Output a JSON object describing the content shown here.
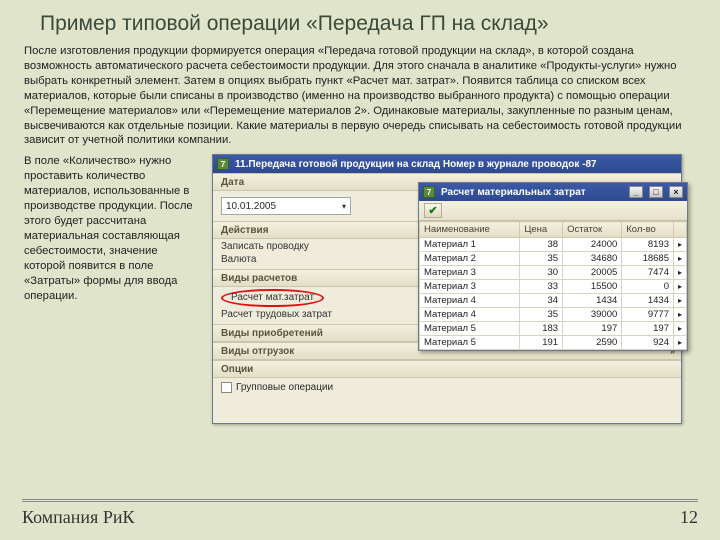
{
  "title": "Пример типовой операции «Передача ГП на склад»",
  "para1": "После изготовления продукции формируется операция «Передача готовой продукции на склад», в которой создана возможность автоматического расчета себестоимости продукции. Для этого сначала в аналитике «Продукты-услуги» нужно выбрать конкретный элемент. Затем в опциях выбрать пункт «Расчет мат. затрат». Появится таблица со списком всех материалов, которые были списаны в производство (именно на производство выбранного продукта) с помощью операции «Перемещение материалов» или «Перемещение материалов 2». Одинаковые материалы, закупленные по разным ценам, высвечиваются как отдельные позиции. Какие материалы в первую очередь списывать на себестоимость готовой продукции зависит от учетной политики компании.",
  "side": "В поле «Количество» нужно проставить количество материалов, использованные в производстве продукции. После этого будет рассчитана материальная составляющая себестоимости, значение которой появится в поле «Затраты» формы для ввода операции.",
  "win_main": {
    "title": "11.Передача готовой продукции на склад     Номер в журнале проводок -87",
    "section_date": "Дата",
    "date": "10.01.2005",
    "section_actions": "Действия",
    "action1": "Записать проводку",
    "action2": "Валюта",
    "section_calc": "Виды расчетов",
    "calc1": "Расчет мат.затрат",
    "calc2": "Расчет трудовых затрат",
    "section_acq": "Виды приобретений",
    "section_ship": "Виды отгрузок",
    "section_opts": "Опции",
    "chk_group": "Групповые операции"
  },
  "win_child": {
    "title": "Расчет материальных затрат",
    "cols": [
      "Наименование",
      "Цена",
      "Остаток",
      "Кол-во"
    ],
    "rows": [
      [
        "Материал 1",
        "38",
        "24000",
        "8193"
      ],
      [
        "Материал 2",
        "35",
        "34680",
        "18685"
      ],
      [
        "Материал 3",
        "30",
        "20005",
        "7474"
      ],
      [
        "Материал 3",
        "33",
        "15500",
        "0"
      ],
      [
        "Материал 4",
        "34",
        "1434",
        "1434"
      ],
      [
        "Материал 4",
        "35",
        "39000",
        "9777"
      ],
      [
        "Материал 5",
        "183",
        "197",
        "197"
      ],
      [
        "Материал 5",
        "191",
        "2590",
        "924"
      ]
    ]
  },
  "footer": {
    "company": "Компания РиК",
    "page": "12"
  }
}
